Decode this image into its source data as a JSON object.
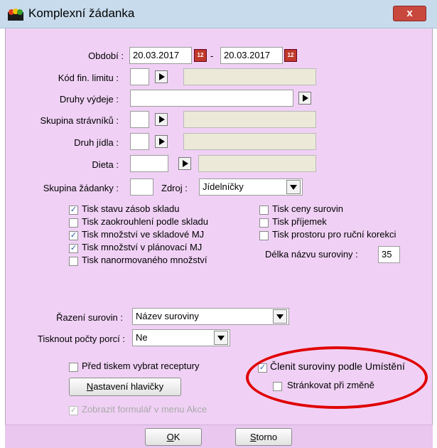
{
  "window": {
    "title": "Komplexní žádanka",
    "close_label": "x",
    "icon": "food-basket-icon"
  },
  "form": {
    "obdobi": {
      "label": "Období :",
      "from": "20.03.2017",
      "dash": "-",
      "to": "20.03.2017",
      "calendar_icon": "calendar-icon",
      "calendar_glyph": "12"
    },
    "kod_fin_limitu": {
      "label": "Kód fin. limitu :",
      "value": "",
      "desc": ""
    },
    "druhy_vydeje": {
      "label": "Druhy výdeje :",
      "value": ""
    },
    "skupina_stravniku": {
      "label": "Skupina strávníků :",
      "value": "",
      "desc": ""
    },
    "druh_jidla": {
      "label": "Druh jídla :",
      "value": "",
      "desc": ""
    },
    "dieta": {
      "label": "Dieta :",
      "value": "",
      "desc": ""
    },
    "skupina_zadanky": {
      "label": "Skupina žádanky :",
      "value": ""
    },
    "zdroj": {
      "label": "Zdroj :",
      "value": "Jídelníčky"
    },
    "checkboxes_left": [
      {
        "label": "Tisk stavu zásob skladu",
        "checked": true
      },
      {
        "label": "Tisk zaokrouhlení podle skladu",
        "checked": false
      },
      {
        "label": "Tisk množství ve skladové MJ",
        "checked": true
      },
      {
        "label": "Tisk množství v plánovací MJ",
        "checked": true
      },
      {
        "label": "Tisk nanormovaného množství",
        "checked": false
      }
    ],
    "checkboxes_right": [
      {
        "label": "Tisk ceny surovin",
        "checked": false
      },
      {
        "label": "Tisk příjemek",
        "checked": false
      },
      {
        "label": "Tisk prostoru pro ruční korekci",
        "checked": false
      }
    ],
    "delka_nazvu": {
      "label": "Délka názvu suroviny :",
      "value": "35"
    },
    "razeni": {
      "label": "Řazení surovin :",
      "value": "Název suroviny"
    },
    "pocty_porci": {
      "label": "Tisknout počty porcí :",
      "value": "Ne"
    },
    "pred_tiskem": {
      "label": "Před tiskem vybrat receptury",
      "checked": false
    },
    "nastaveni": {
      "label_u": "N",
      "label_rest": "astavení hlavičky"
    },
    "zobrazit": {
      "label": "Zobrazit formulář v menu Akce",
      "checked": true
    },
    "clenit": {
      "label": "Členit suroviny podle Umístění",
      "checked": true
    },
    "strankovat": {
      "label": "Stránkovat při změně",
      "checked": false
    }
  },
  "buttons": {
    "ok": {
      "u": "O",
      "rest": "K"
    },
    "storno": {
      "u": "S",
      "rest": "torno"
    }
  },
  "check_glyph": "✓"
}
